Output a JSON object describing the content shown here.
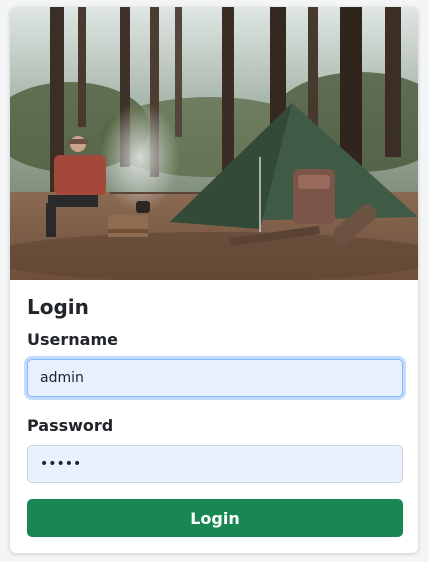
{
  "hero": {
    "alt": "camping-scene-image"
  },
  "form": {
    "title": "Login",
    "username_label": "Username",
    "username_value": "admin",
    "password_label": "Password",
    "password_value": "admin",
    "submit_label": "Login"
  },
  "colors": {
    "button": "#198754",
    "input_bg": "#e8f0fe",
    "focus_ring": "#86b7fe"
  }
}
